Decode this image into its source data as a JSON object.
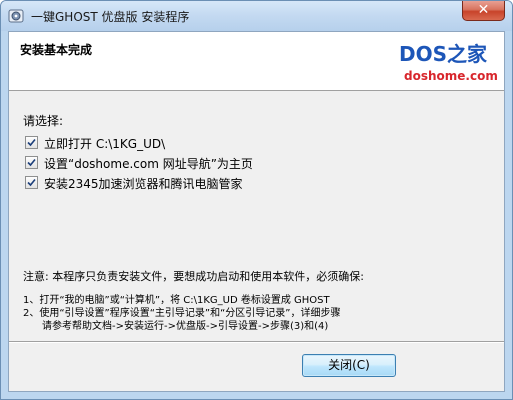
{
  "window": {
    "title": "一键GHOST 优盘版 安装程序",
    "close_glyph": "✕"
  },
  "header": {
    "title": "安装基本完成",
    "logo_main": "DOS之家",
    "logo_sub": "doshome.com"
  },
  "options": {
    "prompt": "请选择:",
    "items": [
      {
        "label": "立即打开 C:\\1KG_UD\\",
        "checked": true
      },
      {
        "label": "设置“doshome.com 网址导航”为主页",
        "checked": true
      },
      {
        "label": "安装2345加速浏览器和腾讯电脑管家",
        "checked": true
      }
    ]
  },
  "notes": {
    "warning": "注意: 本程序只负责安装文件，要想成功启动和使用本软件，必须确保:",
    "step1": "1、打开“我的电脑”或“计算机”，将 C:\\1KG_UD 卷标设置成 GHOST",
    "step2": "2、使用“引导设置”程序设置“主引导记录”和“分区引导记录”，详细步骤",
    "step2_cont": "请参考帮助文档->安装运行->优盘版->引导设置->步骤(3)和(4)"
  },
  "footer": {
    "close_label": "关闭(C)"
  }
}
